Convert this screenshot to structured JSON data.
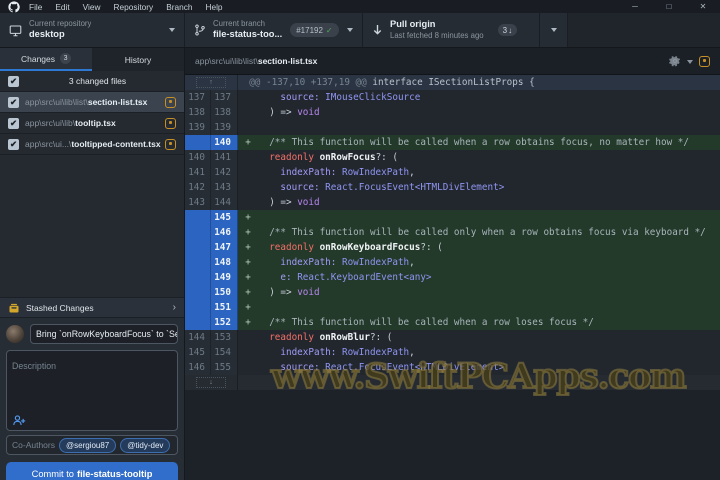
{
  "titlebar": {
    "menus": [
      "File",
      "Edit",
      "View",
      "Repository",
      "Branch",
      "Help"
    ],
    "window_icons": {
      "minimize": "─",
      "maximize": "□",
      "close": "✕"
    }
  },
  "toolbar": {
    "repository": {
      "label": "Current repository",
      "value": "desktop"
    },
    "branch": {
      "label": "Current branch",
      "value": "file-status-too...",
      "pr_number": "#17192",
      "pr_check": "✓"
    },
    "pull": {
      "title": "Pull origin",
      "subtitle": "Last fetched 8 minutes ago",
      "count": "3",
      "count_arrow": "↓"
    }
  },
  "sidebar": {
    "tabs": [
      {
        "label": "Changes",
        "badge": "3",
        "active": true
      },
      {
        "label": "History",
        "active": false
      }
    ],
    "files_header": "3 changed files",
    "files": [
      {
        "prefix": "app\\src\\ui\\lib\\list\\",
        "name": "section-list.tsx",
        "selected": true
      },
      {
        "prefix": "app\\src\\ui\\lib\\",
        "name": "tooltip.tsx",
        "selected": false
      },
      {
        "prefix": "app\\src\\ui...\\",
        "name": "tooltipped-content.tsx",
        "selected": false
      }
    ],
    "stashed_label": "Stashed Changes",
    "stash_chevron": "›",
    "commit": {
      "summary_value": "Bring `onRowKeyboardFocus` to `Se",
      "description_placeholder": "Description",
      "coauthors_label": "Co-Authors",
      "coauthors": [
        "@sergiou87",
        "@tidy-dev"
      ],
      "button_prefix": "Commit to",
      "button_branch": "file-status-tooltip"
    },
    "check_glyph": "✔"
  },
  "main": {
    "file_path_prefix": "app\\src\\ui\\lib\\list\\",
    "file_name": "section-list.tsx"
  },
  "diff": {
    "expand_up": "↑",
    "expand_down": "↓",
    "rows": [
      {
        "t": "hunk",
        "range": "@@ -137,10 +137,19 @@",
        "code": " interface ISectionListProps {"
      },
      {
        "t": "ctx",
        "o": "137",
        "n": "137",
        "segs": [
          [
            "prop",
            "    source:"
          ],
          [
            "typ",
            " IMouseClickSource"
          ]
        ]
      },
      {
        "t": "ctx",
        "o": "138",
        "n": "138",
        "segs": [
          [
            "p",
            "  ) => "
          ],
          [
            "void",
            "void"
          ]
        ]
      },
      {
        "t": "ctx",
        "o": "139",
        "n": "139",
        "segs": []
      },
      {
        "t": "add",
        "n": "140",
        "segs": [
          [
            "cmt",
            "  /** This function will be called when a row obtains focus, no matter how */"
          ]
        ]
      },
      {
        "t": "ctx",
        "o": "140",
        "n": "141",
        "segs": [
          [
            "k",
            "  readonly"
          ],
          [
            "fn",
            " onRowFocus"
          ],
          [
            "p",
            "?: ("
          ]
        ]
      },
      {
        "t": "ctx",
        "o": "141",
        "n": "142",
        "segs": [
          [
            "prop",
            "    indexPath:"
          ],
          [
            "typ",
            " RowIndexPath"
          ],
          [
            "p",
            ","
          ]
        ]
      },
      {
        "t": "ctx",
        "o": "142",
        "n": "143",
        "segs": [
          [
            "prop",
            "    source:"
          ],
          [
            "typ",
            " React.FocusEvent<HTMLDivElement>"
          ]
        ]
      },
      {
        "t": "ctx",
        "o": "143",
        "n": "144",
        "segs": [
          [
            "p",
            "  ) => "
          ],
          [
            "void",
            "void"
          ]
        ]
      },
      {
        "t": "add",
        "n": "145",
        "segs": []
      },
      {
        "t": "add",
        "n": "146",
        "segs": [
          [
            "cmt",
            "  /** This function will be called only when a row obtains focus via keyboard */"
          ]
        ]
      },
      {
        "t": "add",
        "n": "147",
        "segs": [
          [
            "k",
            "  readonly"
          ],
          [
            "fn",
            " onRowKeyboardFocus"
          ],
          [
            "p",
            "?: ("
          ]
        ]
      },
      {
        "t": "add",
        "n": "148",
        "segs": [
          [
            "prop",
            "    indexPath:"
          ],
          [
            "typ",
            " RowIndexPath"
          ],
          [
            "p",
            ","
          ]
        ]
      },
      {
        "t": "add",
        "n": "149",
        "segs": [
          [
            "prop",
            "    e:"
          ],
          [
            "typ",
            " React.KeyboardEvent<any>"
          ]
        ]
      },
      {
        "t": "add",
        "n": "150",
        "segs": [
          [
            "p",
            "  ) => "
          ],
          [
            "void",
            "void"
          ]
        ]
      },
      {
        "t": "add",
        "n": "151",
        "segs": []
      },
      {
        "t": "add",
        "n": "152",
        "segs": [
          [
            "cmt",
            "  /** This function will be called when a row loses focus */"
          ]
        ]
      },
      {
        "t": "ctx",
        "o": "144",
        "n": "153",
        "segs": [
          [
            "k",
            "  readonly"
          ],
          [
            "fn",
            " onRowBlur"
          ],
          [
            "p",
            "?: ("
          ]
        ]
      },
      {
        "t": "ctx",
        "o": "145",
        "n": "154",
        "segs": [
          [
            "prop",
            "    indexPath:"
          ],
          [
            "typ",
            " RowIndexPath"
          ],
          [
            "p",
            ","
          ]
        ]
      },
      {
        "t": "ctx",
        "o": "146",
        "n": "155",
        "segs": [
          [
            "prop",
            "    source:"
          ],
          [
            "typ",
            " React.FocusEvent<HTMLDivElement>"
          ]
        ]
      },
      {
        "t": "expand"
      }
    ]
  },
  "watermark": "www.SwiftPCApps.com",
  "colors": {
    "accent": "#316dca",
    "added_bg": "#23392a",
    "added_gutter": "#2b64c1",
    "modified_icon": "#c69026"
  }
}
